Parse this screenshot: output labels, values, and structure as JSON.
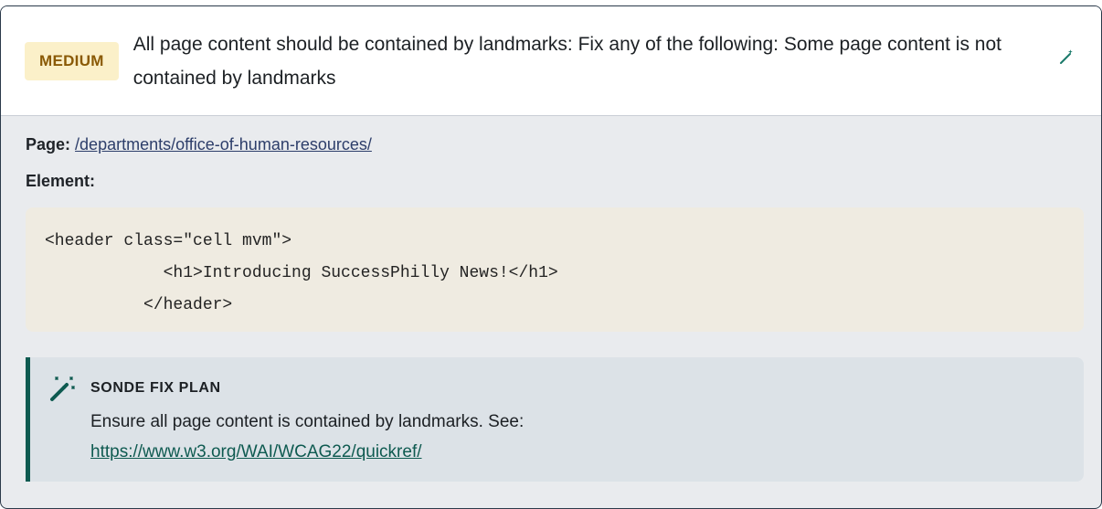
{
  "issue": {
    "severity": "MEDIUM",
    "title": "All page content should be contained by landmarks: Fix any of the following: Some page content is not contained by landmarks",
    "toggle_icon": "magic-wand-icon"
  },
  "details": {
    "page_label": "Page:",
    "page_url": "/departments/office-of-human-resources/",
    "element_label": "Element:",
    "element_code": "<header class=\"cell mvm\">\n            <h1>Introducing SuccessPhilly News!</h1>\n          </header>"
  },
  "fix_plan": {
    "icon": "magic-wand-sparkles-icon",
    "heading": "SONDE FIX PLAN",
    "text": "Ensure all page content is contained by landmarks. See:",
    "link": "https://www.w3.org/WAI/WCAG22/quickref/"
  },
  "colors": {
    "badge_bg": "#fbf0c9",
    "badge_text": "#8a5a06",
    "accent": "#0e5a50",
    "body_bg": "#e9ebee",
    "code_bg": "#efebe1"
  }
}
